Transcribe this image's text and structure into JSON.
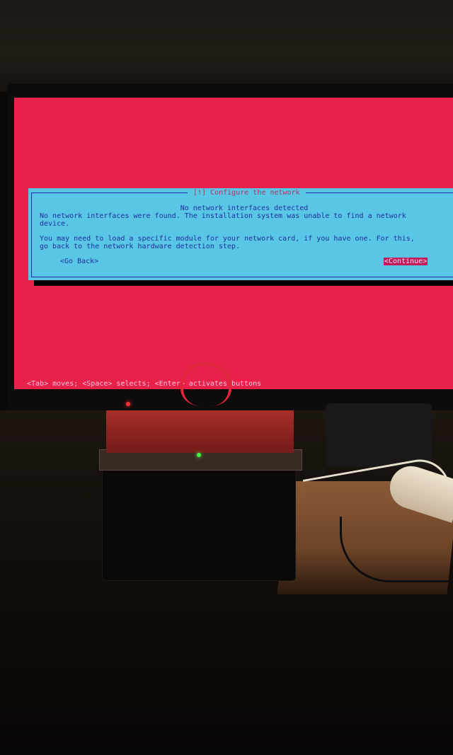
{
  "installer": {
    "dialog_title": "[!] Configure the network",
    "heading": "No network interfaces detected",
    "message_1": "No network interfaces were found. The installation system was unable to find a network\ndevice.",
    "message_2": "You may need to load a specific module for your network card, if you have one. For this,\ngo back to the network hardware detection step.",
    "buttons": {
      "go_back": "<Go Back>",
      "continue": "<Continue>"
    },
    "help_line": "<Tab> moves; <Space> selects; <Enter> activates buttons"
  },
  "colors": {
    "background": "#e8214a",
    "dialog": "#59c6e6",
    "dialog_text": "#1f2f9a",
    "selected_button": "#c21a5a"
  }
}
